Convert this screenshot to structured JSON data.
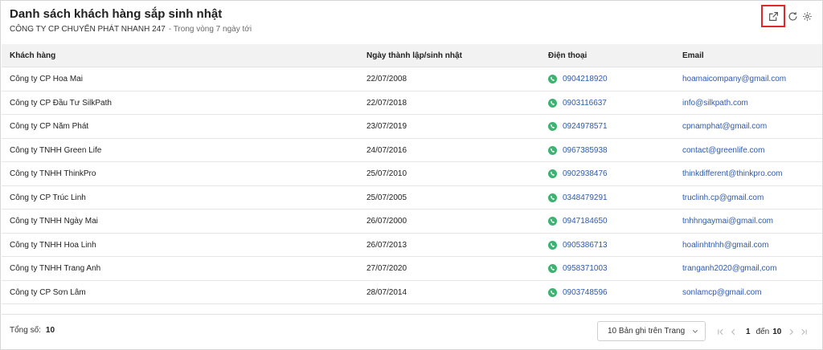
{
  "header": {
    "title": "Danh sách khách hàng sắp sinh nhật",
    "company": "CÔNG TY CP CHUYỂN PHÁT NHANH 247",
    "period": "- Trong vòng 7 ngày tới"
  },
  "toolbar": {
    "icons": [
      "external-link-icon",
      "refresh-icon",
      "gear-icon"
    ]
  },
  "table": {
    "columns": [
      "Khách hàng",
      "Ngày thành lập/sinh nhật",
      "Điện thoại",
      "Email"
    ],
    "rows": [
      {
        "name": "Công ty CP Hoa Mai",
        "date": "22/07/2008",
        "phone": "0904218920",
        "email": "hoamaicompany@gmail.com"
      },
      {
        "name": "Công ty CP Đầu Tư SilkPath",
        "date": "22/07/2018",
        "phone": "0903116637",
        "email": "info@silkpath.com"
      },
      {
        "name": "Công ty CP Năm Phát",
        "date": "23/07/2019",
        "phone": "0924978571",
        "email": "cpnamphat@gmail.com"
      },
      {
        "name": "Công ty TNHH Green Life",
        "date": "24/07/2016",
        "phone": "0967385938",
        "email": "contact@greenlife.com"
      },
      {
        "name": "Công ty TNHH ThinkPro",
        "date": "25/07/2010",
        "phone": "0902938476",
        "email": "thinkdifferent@thinkpro.com"
      },
      {
        "name": "Công ty CP Trúc Linh",
        "date": "25/07/2005",
        "phone": "0348479291",
        "email": "truclinh.cp@gmail.com"
      },
      {
        "name": "Công ty TNHH Ngày Mai",
        "date": "26/07/2000",
        "phone": "0947184650",
        "email": "tnhhngaymai@gmail.com"
      },
      {
        "name": "Công ty TNHH Hoa Linh",
        "date": "26/07/2013",
        "phone": "0905386713",
        "email": "hoalinhtnhh@gmail.com"
      },
      {
        "name": "Công ty TNHH Trang Anh",
        "date": "27/07/2020",
        "phone": "0958371003",
        "email": "tranganh2020@gmail,com"
      },
      {
        "name": "Công ty CP Sơn Lâm",
        "date": "28/07/2014",
        "phone": "0903748596",
        "email": "sonlamcp@gmail.com"
      }
    ]
  },
  "footer": {
    "total_label": "Tổng số:",
    "total_value": "10",
    "page_size": "10 Bản ghi trên Trang",
    "current_page": "1",
    "of_label": "đến",
    "total_pages": "10"
  },
  "colors": {
    "link": "#2e5aac",
    "phone_icon": "#3cb371",
    "highlight": "#e12828"
  }
}
